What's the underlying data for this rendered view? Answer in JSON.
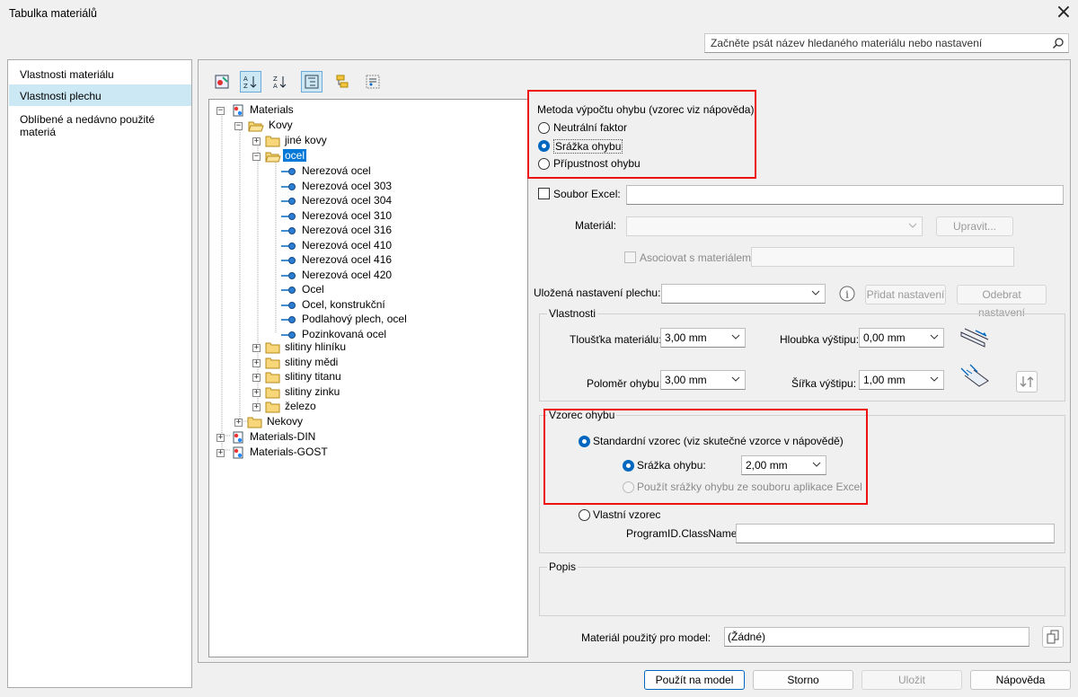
{
  "window": {
    "title": "Tabulka materiálů"
  },
  "search": {
    "placeholder": "Začněte psát název hledaného materiálu nebo nastavení"
  },
  "nav": {
    "items": [
      {
        "label": "Vlastnosti materiálu"
      },
      {
        "label": "Vlastnosti plechu"
      },
      {
        "label": "Oblíbené a nedávno použité materiá"
      }
    ]
  },
  "tree": {
    "materials": "Materials",
    "kovy": "Kovy",
    "jine_kovy": "jiné kovy",
    "ocel": "ocel",
    "steels": [
      "Nerezová ocel",
      "Nerezová ocel 303",
      "Nerezová ocel 304",
      "Nerezová ocel 310",
      "Nerezová ocel 316",
      "Nerezová ocel 410",
      "Nerezová ocel 416",
      "Nerezová ocel 420",
      "Ocel",
      "Ocel, konstrukční",
      "Podlahový plech, ocel",
      "Pozinkovaná ocel"
    ],
    "slitiny": [
      "slitiny hliníku",
      "slitiny mědi",
      "slitiny titanu",
      "slitiny zinku",
      "železo"
    ],
    "nekovy": "Nekovy",
    "din": "Materials-DIN",
    "gost": "Materials-GOST"
  },
  "bend_method": {
    "title": "Metoda výpočtu ohybu (vzorec viz nápověda)",
    "options": [
      "Neutrální faktor",
      "Srážka ohybu",
      "Přípustnost ohybu"
    ],
    "selected": "Srážka ohybu"
  },
  "excel": {
    "checkbox_label": "Soubor Excel:",
    "material_label": "Materiál:",
    "edit_button": "Upravit...",
    "associate_label": "Asociovat s materiálem"
  },
  "saved": {
    "label": "Uložená nastavení plechu:",
    "add_button": "Přidat nastavení",
    "remove_button": "Odebrat nastavení"
  },
  "properties": {
    "title": "Vlastnosti",
    "thickness_label": "Tloušťka materiálu:",
    "thickness_value": "3,00 mm",
    "relief_depth_label": "Hloubka výštipu:",
    "relief_depth_value": "0,00 mm",
    "bend_radius_label": "Poloměr ohybu:",
    "bend_radius_value": "3,00 mm",
    "relief_width_label": "Šířka výštipu:",
    "relief_width_value": "1,00 mm"
  },
  "bend_formula": {
    "title": "Vzorec ohybu",
    "standard_label": "Standardní vzorec (viz skutečné vzorce v nápovědě)",
    "deduction_label": "Srážka ohybu:",
    "deduction_value": "2,00 mm",
    "excel_deduction_label": "Použít srážky ohybu ze souboru aplikace Excel",
    "custom_label": "Vlastní vzorec",
    "progid_label": "ProgramID.ClassName:"
  },
  "description": {
    "title": "Popis"
  },
  "model_material": {
    "label": "Materiál použitý pro model:",
    "value": "(Žádné)"
  },
  "footer": {
    "apply": "Použít na model",
    "cancel": "Storno",
    "save": "Uložit",
    "help": "Nápověda"
  },
  "colors": {
    "accent": "#0067c0",
    "selection": "#0078d7",
    "highlight_box": "#e11111"
  }
}
